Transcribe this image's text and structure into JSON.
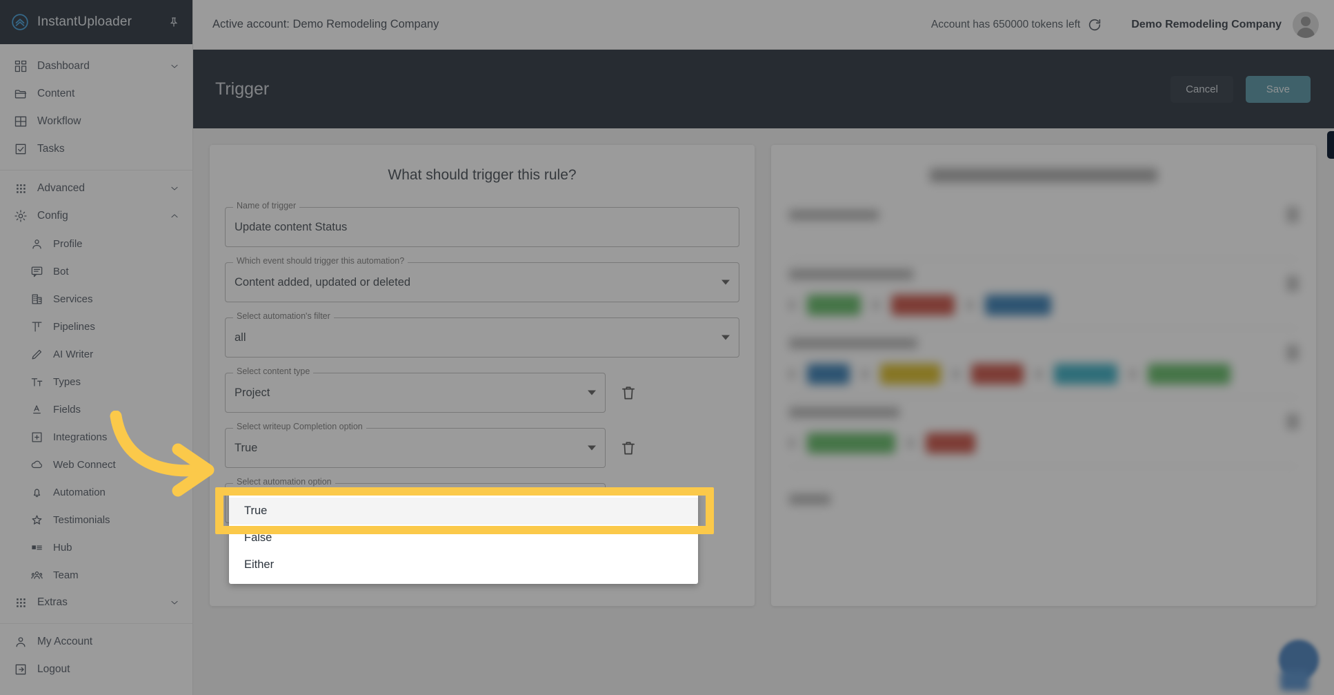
{
  "app": {
    "name": "InstantUploader",
    "logo_icon": "double-chevron-up-circle-icon",
    "pin_icon": "pin-icon"
  },
  "sidebar": {
    "groups": [
      {
        "items": [
          {
            "label": "Dashboard",
            "icon": "dashboard-grid-icon",
            "chevron": "chevron-down-icon",
            "sub": false
          },
          {
            "label": "Content",
            "icon": "folder-icon",
            "chevron": "",
            "sub": false
          },
          {
            "label": "Workflow",
            "icon": "table-grid-icon",
            "chevron": "",
            "sub": false
          },
          {
            "label": "Tasks",
            "icon": "checkbox-icon",
            "chevron": "",
            "sub": false
          }
        ]
      },
      {
        "items": [
          {
            "label": "Advanced",
            "icon": "apps-dots-icon",
            "chevron": "chevron-down-icon",
            "sub": false
          },
          {
            "label": "Config",
            "icon": "gear-icon",
            "chevron": "chevron-up-icon",
            "sub": false
          },
          {
            "label": "Profile",
            "icon": "person-icon",
            "chevron": "",
            "sub": true
          },
          {
            "label": "Bot",
            "icon": "chat-bubble-icon",
            "chevron": "",
            "sub": true
          },
          {
            "label": "Services",
            "icon": "building-icon",
            "chevron": "",
            "sub": true
          },
          {
            "label": "Pipelines",
            "icon": "pipeline-icon",
            "chevron": "",
            "sub": true
          },
          {
            "label": "AI Writer",
            "icon": "pencil-icon",
            "chevron": "",
            "sub": true
          },
          {
            "label": "Types",
            "icon": "text-format-icon",
            "chevron": "",
            "sub": true
          },
          {
            "label": "Fields",
            "icon": "font-underline-icon",
            "chevron": "",
            "sub": true
          },
          {
            "label": "Integrations",
            "icon": "plus-square-icon",
            "chevron": "",
            "sub": true
          },
          {
            "label": "Web Connect",
            "icon": "cloud-icon",
            "chevron": "",
            "sub": true
          },
          {
            "label": "Automation",
            "icon": "bell-icon",
            "chevron": "",
            "sub": true
          },
          {
            "label": "Testimonials",
            "icon": "star-icon",
            "chevron": "",
            "sub": true
          },
          {
            "label": "Hub",
            "icon": "card-list-icon",
            "chevron": "",
            "sub": true
          },
          {
            "label": "Team",
            "icon": "people-icon",
            "chevron": "",
            "sub": true
          },
          {
            "label": "Extras",
            "icon": "apps-dots-icon",
            "chevron": "chevron-down-icon",
            "sub": false
          }
        ]
      },
      {
        "items": [
          {
            "label": "My Account",
            "icon": "person-icon",
            "chevron": "",
            "sub": false
          },
          {
            "label": "Logout",
            "icon": "logout-icon",
            "chevron": "",
            "sub": false
          }
        ]
      }
    ]
  },
  "topbar": {
    "active_account": "Active account: Demo Remodeling Company",
    "tokens": "Account has 650000 tokens left",
    "refresh_icon": "refresh-icon",
    "company": "Demo Remodeling Company",
    "avatar_icon": "avatar-icon"
  },
  "page_header": {
    "title": "Trigger",
    "cancel_label": "Cancel",
    "save_label": "Save"
  },
  "form": {
    "title": "What should trigger this rule?",
    "fields": [
      {
        "label": "Name of trigger",
        "value": "Update content Status",
        "type": "text",
        "has_trash": false,
        "narrow": false
      },
      {
        "label": "Which event should trigger this automation?",
        "value": "Content added, updated or deleted",
        "type": "select",
        "has_trash": false,
        "narrow": false
      },
      {
        "label": "Select automation's filter",
        "value": "all",
        "type": "select",
        "has_trash": false,
        "narrow": false
      },
      {
        "label": "Select content type",
        "value": "Project",
        "type": "select",
        "has_trash": true,
        "narrow": true
      },
      {
        "label": "Select writeup Completion option",
        "value": "True",
        "type": "select",
        "has_trash": true,
        "narrow": true
      },
      {
        "label": "Select automation option",
        "value": "True",
        "type": "select",
        "has_trash": true,
        "narrow": true
      }
    ]
  },
  "dropdown": {
    "options": [
      {
        "label": "True",
        "hovered": true
      },
      {
        "label": "False",
        "hovered": false
      },
      {
        "label": "Either",
        "hovered": false
      }
    ]
  },
  "highlight": {
    "color": "#FBC94A",
    "arrow_icon": "curved-arrow-right-icon"
  },
  "right_panel": {
    "blurred": true,
    "chips": [
      {
        "row": 1,
        "colors": [
          "#4caf50",
          "#c0392b",
          "#1a6aa8"
        ]
      },
      {
        "row": 2,
        "colors": [
          "#1a6aa8",
          "#d4b106",
          "#c0392b",
          "#1da0b8",
          "#4caf50"
        ]
      },
      {
        "row": 3,
        "colors": [
          "#4caf50",
          "#c0392b"
        ]
      }
    ]
  },
  "chat_widget": {
    "icon": "chat-bubble-icon"
  }
}
